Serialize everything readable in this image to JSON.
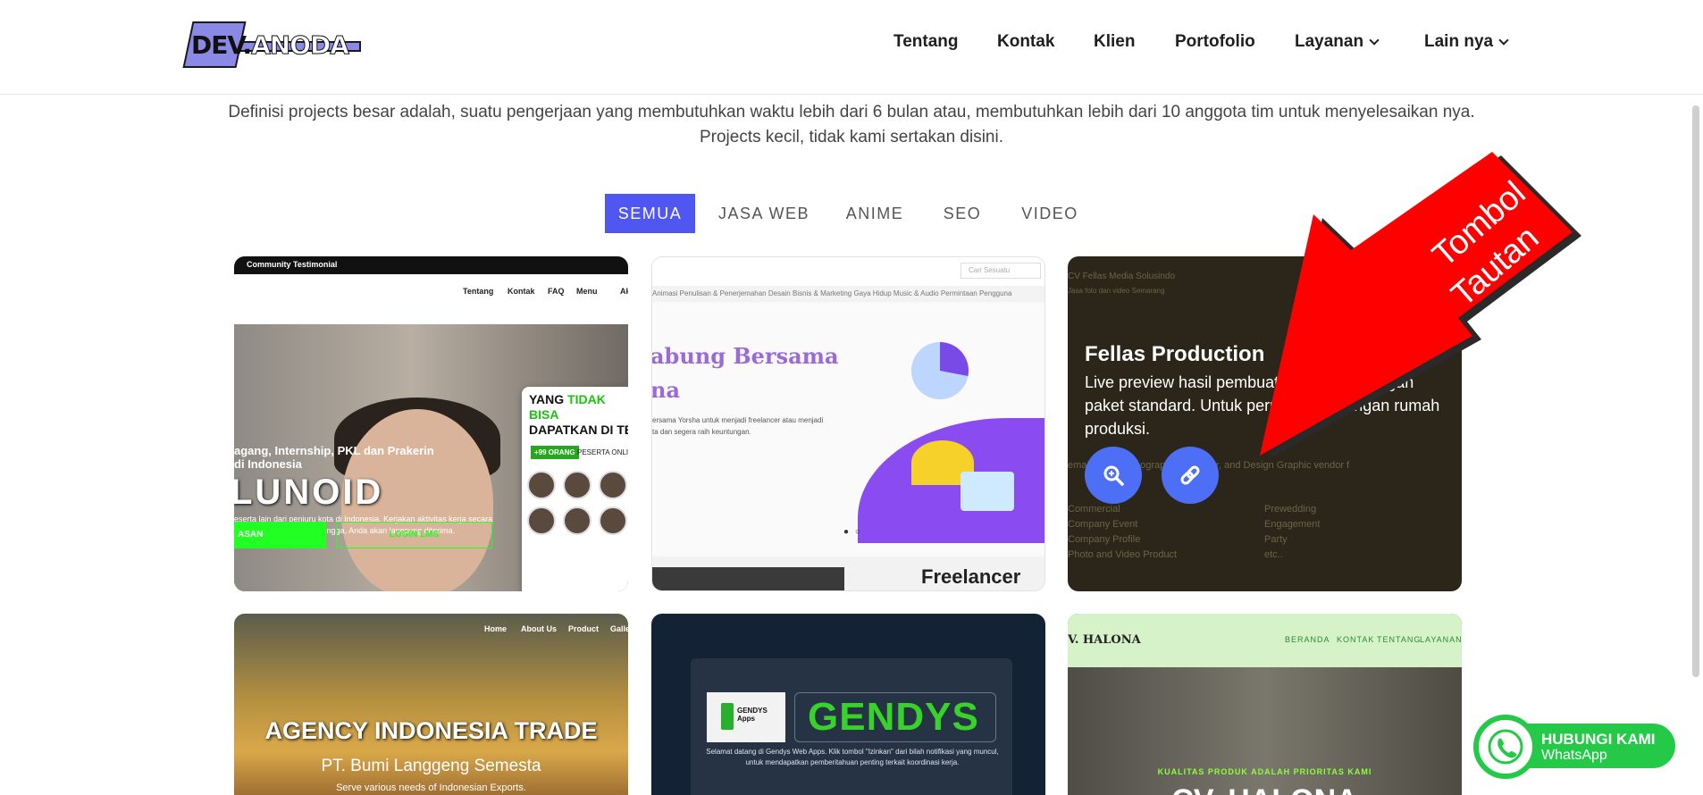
{
  "header": {
    "logo_text_1": "DEV",
    "logo_text_2": "ANODA",
    "nav": [
      {
        "label": "Tentang"
      },
      {
        "label": "Kontak"
      },
      {
        "label": "Klien"
      },
      {
        "label": "Portofolio"
      },
      {
        "label": "Layanan"
      },
      {
        "label": "Lain nya"
      }
    ]
  },
  "description": "Definisi projects besar adalah, suatu pengerjaan yang membutuhkan waktu lebih dari 6 bulan atau, membutuhkan lebih dari 10 anggota tim untuk menyelesaikan nya. Projects kecil, tidak kami sertakan disini.",
  "filters": [
    {
      "label": "SEMUA",
      "active": true
    },
    {
      "label": "JASA WEB"
    },
    {
      "label": "ANIME"
    },
    {
      "label": "SEO"
    },
    {
      "label": "VIDEO"
    }
  ],
  "cards": {
    "c1": {
      "topbar": "Community   Testimonial",
      "nav": [
        "Tentang",
        "Kontak",
        "FAQ",
        "Menu",
        "Ak"
      ],
      "panel_title_a": "YANG",
      "panel_title_b": "TIDAK BISA",
      "panel_title_c": "DAPATKAN DI TE",
      "badge": "+99 ORANG",
      "badge_text": "PESERTA ONLI",
      "sub": "agang, Internship, PKL dan Prakerin",
      "sub2": "di Indonesia",
      "big": "LUNOID",
      "body": "eserta lain dari penjuru kota di Indonesia. Kerjakan aktivitas kerja secara afaran tanpa seleksi. Sehingga, Anda akan langsung diterima.",
      "btn_left": "ASAN",
      "btn_right": "LOGIN LMS"
    },
    "c2": {
      "search_placeholder": "Cari Sesuatu",
      "menu": "Animasi   Penulisan & Penerjemahan   Desain   Bisnis & Marketing   Gaya Hidup   Music & Audio   Permintaan Pengguna",
      "h1": "abung Bersama",
      "h2": "na",
      "body": "ersama Yorsha untuk menjadi freelancer atau menjadi ta dan segera raih keuntungan.",
      "footer": "Freelancer"
    },
    "c3": {
      "bg_brand": "CV Fellas Media Solusindo",
      "bg_tag": "Jasa foto dan video Semarang",
      "bg_desc": "ema    Photo, Videography, Animator, and Design Graphic vendor f",
      "bg_list_left": [
        "Commercial",
        "Company Event",
        "Company Profile",
        "Photo and Video Product"
      ],
      "bg_list_right": [
        "Prewedding",
        "Engagement",
        "Party",
        "etc.."
      ],
      "title": "Fellas Production",
      "text": "Live preview hasil pembuatan website dengan paket standard. Untuk perusahaan dengan rumah produksi."
    },
    "c4": {
      "nav": [
        "Home",
        "About Us",
        "Product",
        "Galle"
      ],
      "h": "AGENCY INDONESIA TRADE",
      "s": "PT. Bumi Langgeng Semesta",
      "s2": "Serve various needs of Indonesian Exports."
    },
    "c5": {
      "logo": "GENDYS Apps",
      "title": "GENDYS",
      "desc": "Selamat datang di Gendys Web Apps. Klik tombol \"Izinkan\" dari bilah notifikasi yang muncul, untuk mendapatkan pemberitahuan penting terkait koordinasi kerja."
    },
    "c6": {
      "brand": "V. HALONA",
      "nav": [
        "BERANDA",
        "KONTAK",
        "TENTANG",
        "LAYANAN"
      ],
      "tag": "KUALITAS PRODUK ADALAH PRIORITAS KAMI",
      "big": "CV. HALONA"
    }
  },
  "annotation": {
    "line1": "Tombol",
    "line2": "Tautan",
    "color": "#ff0000"
  },
  "whatsapp": {
    "line1": "HUBUNGI KAMI",
    "line2": "WhatsApp",
    "color": "#25c948"
  },
  "colors": {
    "accent": "#5056f0",
    "button_blue": "#4d6ff5"
  }
}
